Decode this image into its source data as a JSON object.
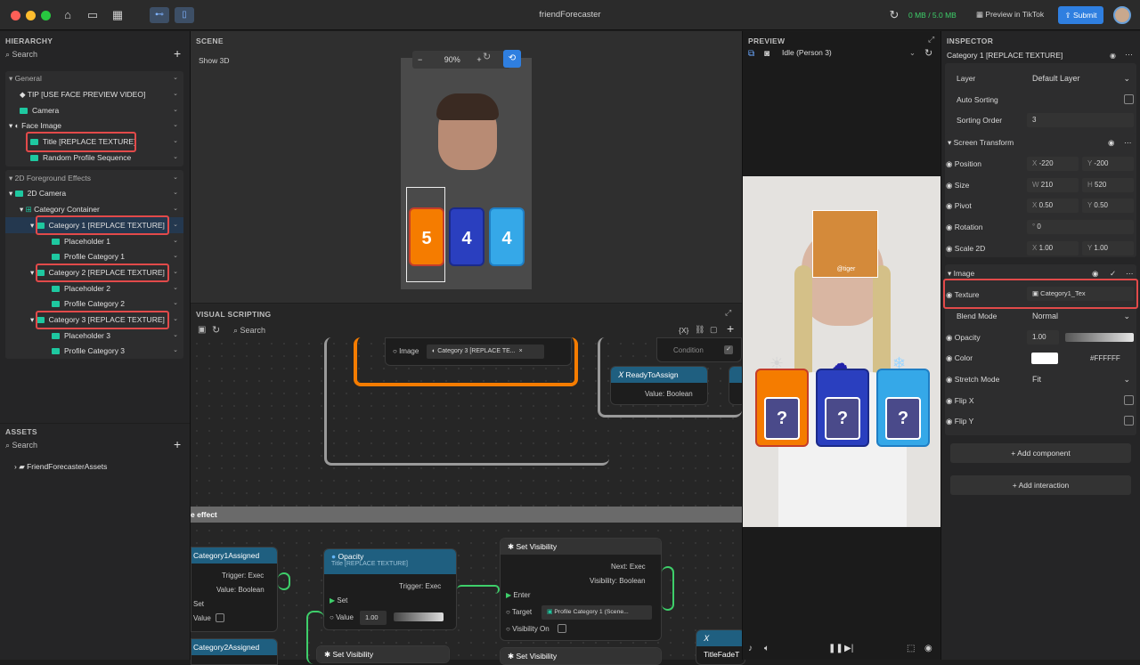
{
  "app": {
    "title": "friendForecaster",
    "storage": "0 MB / 5.0 MB",
    "preview_btn": "Preview in TikTok",
    "submit": "Submit"
  },
  "hierarchy": {
    "title": "HIERARCHY",
    "search": "Search",
    "items": [
      {
        "label": "General"
      },
      {
        "label": "TIP  [USE FACE PREVIEW VIDEO]"
      },
      {
        "label": "Camera"
      },
      {
        "label": "Face Image"
      },
      {
        "label": "Title [REPLACE TEXTURE]"
      },
      {
        "label": "Random Profile Sequence"
      },
      {
        "label": "2D Foreground Effects"
      },
      {
        "label": "2D Camera"
      },
      {
        "label": "Category Container"
      },
      {
        "label": "Category 1 [REPLACE TEXTURE]"
      },
      {
        "label": "Placeholder 1"
      },
      {
        "label": "Profile Category 1"
      },
      {
        "label": "Category 2 [REPLACE TEXTURE]"
      },
      {
        "label": "Placeholder 2"
      },
      {
        "label": "Profile Category 2"
      },
      {
        "label": "Category 3 [REPLACE TEXTURE]"
      },
      {
        "label": "Placeholder 3"
      },
      {
        "label": "Profile Category 3"
      }
    ]
  },
  "assets": {
    "title": "ASSETS",
    "search": "Search",
    "folder": "FriendForecasterAssets"
  },
  "scene": {
    "title": "SCENE",
    "show3d": "Show 3D",
    "zoom": "90%",
    "cards": [
      "5",
      "4",
      "4"
    ]
  },
  "scripting": {
    "title": "VISUAL SCRIPTING",
    "search": "Search",
    "var_btn": "{X}",
    "group_label": "e effect",
    "image_port": "Image",
    "image_val": "Category 3 [REPLACE TE...",
    "condition": "Condition",
    "ready_title": "ReadyToAssign",
    "ready_val": "Value: Boolean",
    "cat1_title": "Category1Assigned",
    "cat1_trigger": "Trigger: Exec",
    "cat1_value": "Value: Boolean",
    "cat1_set": "Set",
    "cat1_valin": "Value",
    "cat2_title": "Category2Assigned",
    "opacity_title": "Opacity",
    "opacity_sub": "Title [REPLACE TEXTURE]",
    "opacity_trigger": "Trigger: Exec",
    "opacity_set": "Set",
    "opacity_value": "Value",
    "opacity_num": "1.00",
    "setvis_title": "Set Visibility",
    "setvis_next": "Next: Exec",
    "setvis_vis": "Visibility: Boolean",
    "setvis_enter": "Enter",
    "setvis_target": "Target",
    "setvis_target_val": "Profile Category 1 (Scene...",
    "setvis_on": "Visibility On",
    "setvis2_title": "Set Visibility",
    "setvis3_title": "Set Visibility",
    "titlefade": "TitleFadeT"
  },
  "preview": {
    "title": "PREVIEW",
    "dropdown": "Idle (Person 3)",
    "tiger_caption": "@tiger"
  },
  "inspector": {
    "title": "INSPECTOR",
    "object": "Category 1 [REPLACE TEXTURE]",
    "layer_label": "Layer",
    "layer_val": "Default Layer",
    "auto_sort": "Auto Sorting",
    "sort_order": "Sorting Order",
    "sort_val": "3",
    "screen_transform": "Screen Transform",
    "position": "Position",
    "pos_x": "-220",
    "pos_y": "-200",
    "size": "Size",
    "size_w": "210",
    "size_h": "520",
    "pivot": "Pivot",
    "pivot_x": "0.50",
    "pivot_y": "0.50",
    "rotation": "Rotation",
    "rot_val": "0",
    "scale": "Scale 2D",
    "scale_x": "1.00",
    "scale_y": "1.00",
    "image": "Image",
    "texture": "Texture",
    "texture_val": "Category1_Tex",
    "blend": "Blend Mode",
    "blend_val": "Normal",
    "opacity": "Opacity",
    "opacity_val": "1.00",
    "color": "Color",
    "color_val": "#FFFFFF",
    "stretch": "Stretch Mode",
    "stretch_val": "Fit",
    "flipx": "Flip X",
    "flipy": "Flip Y",
    "add_component": "+ Add component",
    "add_interaction": "+ Add interaction"
  },
  "colors": {
    "accent": "#1e88e5",
    "highlight": "#e24a4a",
    "orange": "#f57c00",
    "teal": "#1ec8a0"
  }
}
